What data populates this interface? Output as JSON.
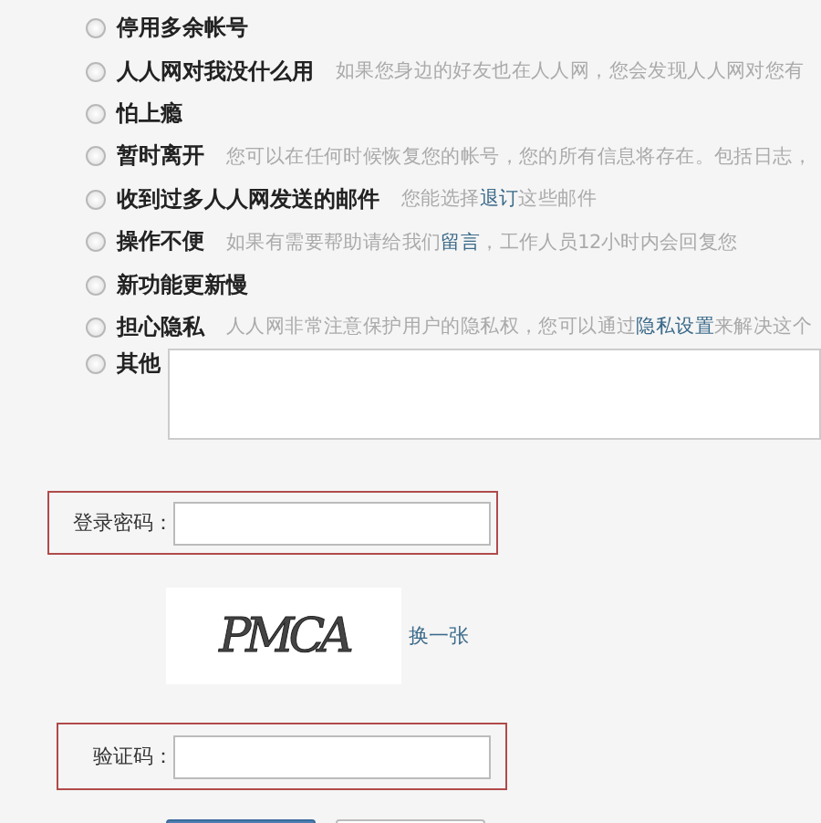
{
  "reasons": [
    {
      "label": "停用多余帐号",
      "selected": false
    },
    {
      "label": "人人网对我没什么用",
      "selected": false,
      "description": [
        {
          "text": "如果您身边的好友也在人人网，您会发现人人网对您有",
          "link": false
        }
      ]
    },
    {
      "label": "怕上瘾",
      "selected": false
    },
    {
      "label": "暂时离开",
      "selected": false,
      "description": [
        {
          "text": "您可以在任何时候恢复您的帐号，您的所有信息将存在。包括日志，",
          "link": false
        }
      ]
    },
    {
      "label": "收到过多人人网发送的邮件",
      "selected": false,
      "description": [
        {
          "text": "您能选择",
          "link": false
        },
        {
          "text": "退订",
          "link": true
        },
        {
          "text": "这些邮件",
          "link": false
        }
      ]
    },
    {
      "label": "操作不便",
      "selected": false,
      "description": [
        {
          "text": "如果有需要帮助请给我们",
          "link": false
        },
        {
          "text": "留言",
          "link": true
        },
        {
          "text": "，工作人员12小时内会回复您",
          "link": false
        }
      ]
    },
    {
      "label": "新功能更新慢",
      "selected": false
    },
    {
      "label": "担心隐私",
      "selected": false,
      "description": [
        {
          "text": "人人网非常注意保护用户的隐私权，您可以通过",
          "link": false
        },
        {
          "text": "隐私设置",
          "link": true
        },
        {
          "text": "来解决这个",
          "link": false
        }
      ]
    }
  ],
  "other": {
    "label": "其他",
    "selected": false
  },
  "password": {
    "label": "登录密码："
  },
  "captcha": {
    "text": "PMCA",
    "refresh": "换一张"
  },
  "verification": {
    "label": "验证码："
  },
  "buttons": [
    {
      "kind": "primary"
    },
    {
      "kind": "secondary"
    }
  ]
}
